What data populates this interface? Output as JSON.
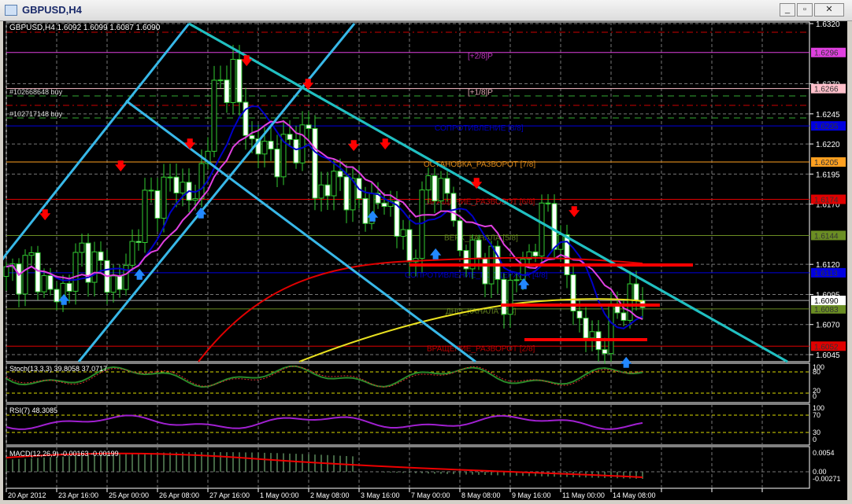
{
  "window": {
    "title": "GBPUSD,H4",
    "minimize": "_",
    "restore": "▫",
    "close": "✕"
  },
  "main": {
    "info": "GBPUSD,H4  1.6092 1.6099 1.6087 1.6090",
    "orders": [
      "#102668648 buy",
      "#102717148 buy"
    ],
    "price_axis": [
      "1.6320",
      "1.6270",
      "1.6245",
      "1.6220",
      "1.6195",
      "1.6170",
      "1.6120",
      "1.6095",
      "1.6070",
      "1.6045"
    ],
    "current_price": "1.6090",
    "levels": [
      {
        "price": 1.6296,
        "tag": "1.6296",
        "label": "[+2/8]P",
        "color": "#e040e0"
      },
      {
        "price": 1.6266,
        "tag": "1.6266",
        "label": "[+1/8]P",
        "color": "#ffc0cb"
      },
      {
        "price": 1.6235,
        "tag": "1.6235",
        "label": "СОПРОТИВЛЕНИЕ [8/8]",
        "color": "#0000e0"
      },
      {
        "price": 1.6205,
        "tag": "1.6205",
        "label": "ОСТАНОВКА_РАЗВОРОТ [7/8]",
        "color": "#ffa020"
      },
      {
        "price": 1.6174,
        "tag": "1.6174",
        "label": "ВРАЩЕНИЕ_РАЗВОРОТ [6/8]",
        "color": "#e00000"
      },
      {
        "price": 1.6144,
        "tag": "1.6144",
        "label": "ВЕРХ_КАНАЛА [5/8]",
        "color": "#6b8e23"
      },
      {
        "price": 1.6113,
        "tag": "1.6113",
        "label": "СОПРОТИВЛЕНИЕ_ПОДДЕРЖКА [4/8]",
        "color": "#0000e0"
      },
      {
        "price": 1.6083,
        "tag": "1.6083",
        "label": "ДНО_КАНАЛА [3/8]",
        "color": "#6b8e23"
      },
      {
        "price": 1.6052,
        "tag": "1.6052",
        "label": "ВРАЩЕНИЕ_РАЗВОРОТ [2/8]",
        "color": "#e00000"
      }
    ],
    "price_path": [
      [
        0,
        1.611
      ],
      [
        4,
        1.612
      ],
      [
        8,
        1.609
      ],
      [
        12,
        1.613
      ],
      [
        18,
        1.61
      ],
      [
        22,
        1.617
      ],
      [
        27,
        1.619
      ],
      [
        30,
        1.617
      ],
      [
        33,
        1.626
      ],
      [
        36,
        1.628
      ],
      [
        37,
        1.625
      ],
      [
        39,
        1.622
      ],
      [
        43,
        1.621
      ],
      [
        48,
        1.623
      ],
      [
        49,
        1.618
      ],
      [
        53,
        1.619
      ],
      [
        56,
        1.617
      ],
      [
        61,
        1.617
      ],
      [
        64,
        1.612
      ],
      [
        67,
        1.619
      ],
      [
        70,
        1.618
      ],
      [
        72,
        1.613
      ],
      [
        77,
        1.612
      ],
      [
        79,
        1.609
      ],
      [
        84,
        1.614
      ],
      [
        86,
        1.617
      ],
      [
        89,
        1.611
      ],
      [
        91,
        1.607
      ],
      [
        94,
        1.605
      ],
      [
        98,
        1.609
      ],
      [
        101,
        1.609
      ]
    ]
  },
  "stoch": {
    "label": "Stoch(13,3,3) 39.8058 37.0717",
    "axis": [
      "100",
      "80",
      "20",
      "0"
    ]
  },
  "rsi": {
    "label": "RSI(7) 48.3085",
    "axis": [
      "100",
      "70",
      "30",
      "0"
    ]
  },
  "macd": {
    "label": "MACD(12,26,9) -0.00163 -0.00199",
    "axis": [
      "0.0054",
      "0.00",
      "-0.00271"
    ]
  },
  "time_axis": [
    "20 Apr 2012",
    "23 Apr 16:00",
    "25 Apr 00:00",
    "26 Apr 08:00",
    "27 Apr 16:00",
    "1 May 00:00",
    "2 May 08:00",
    "3 May 16:00",
    "7 May 00:00",
    "8 May 08:00",
    "9 May 16:00",
    "11 May 00:00",
    "14 May 08:00"
  ]
}
